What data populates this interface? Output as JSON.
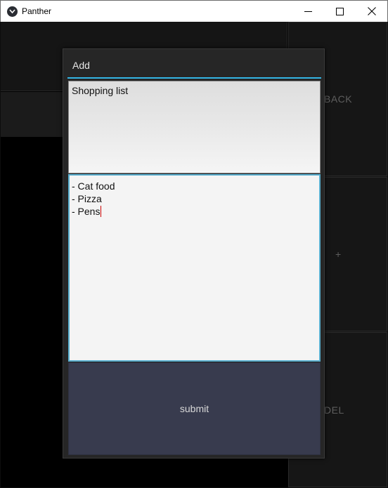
{
  "window": {
    "title": "Panther",
    "controls": {
      "minimize": "minimize-icon",
      "maximize": "maximize-icon",
      "close": "close-icon"
    }
  },
  "sidebar": {
    "back_label": "BACK",
    "add_label": "+",
    "delete_label": "DEL"
  },
  "dialog": {
    "title": "Add",
    "title_field_value": "Shopping list",
    "body_lines": [
      "- Cat food",
      "- Pizza",
      "- Pens"
    ],
    "submit_label": "submit"
  },
  "colors": {
    "accent": "#33b5e5",
    "submit_bg": "#383b4e",
    "background": "#000000"
  }
}
